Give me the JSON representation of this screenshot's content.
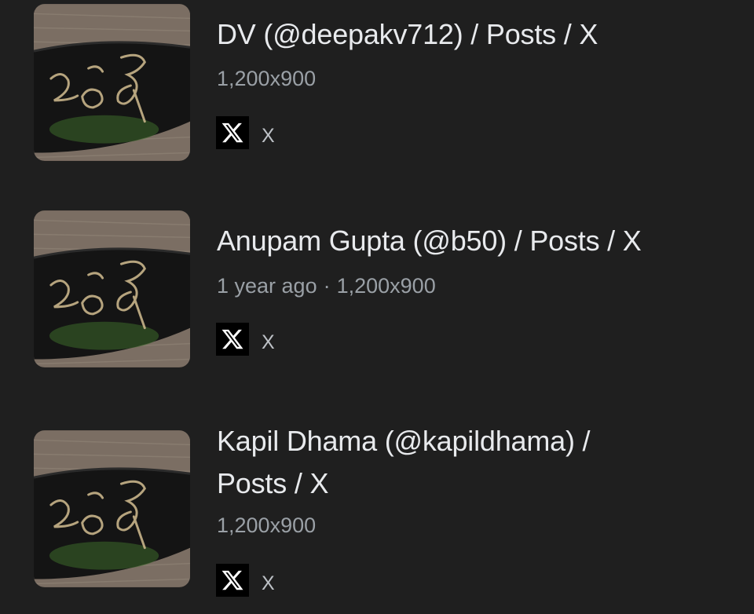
{
  "results": [
    {
      "title": "DV (@deepakv712) / Posts / X",
      "age": "",
      "dimensions": "1,200x900",
      "source": {
        "icon": "x-logo-icon",
        "name": "X"
      },
      "thumbnail": "graffiti-on-wall-thumbnail"
    },
    {
      "title": "Anupam Gupta (@b50) / Posts / X",
      "age": "1 year ago",
      "separator": "·",
      "dimensions": "1,200x900",
      "source": {
        "icon": "x-logo-icon",
        "name": "X"
      },
      "thumbnail": "graffiti-on-wall-thumbnail"
    },
    {
      "title_line1": "Kapil Dhama (@kapildhama) /",
      "title_line2": "Posts / X",
      "age": "",
      "dimensions": "1,200x900",
      "source": {
        "icon": "x-logo-icon",
        "name": "X"
      },
      "thumbnail": "graffiti-on-wall-thumbnail"
    }
  ],
  "colors": {
    "background": "#1f1f1f",
    "title": "#e8eaed",
    "meta": "#9aa0a6",
    "source": "#bdc1c6"
  }
}
